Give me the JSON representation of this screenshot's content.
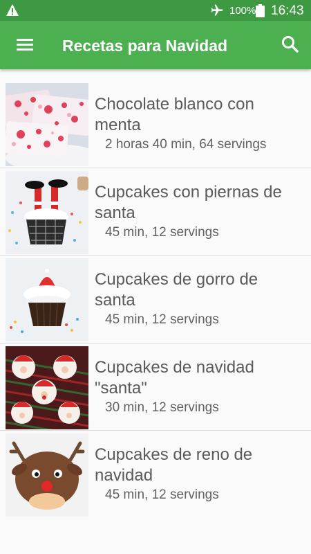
{
  "status_bar": {
    "battery_percent": "100%",
    "time": "16:43",
    "icons": [
      "warning-icon",
      "airplane-mode-icon",
      "battery-icon"
    ]
  },
  "app_bar": {
    "title": "Recetas para Navidad",
    "icons": [
      "menu-icon",
      "search-icon"
    ]
  },
  "colors": {
    "status_bar": "#3e9a42",
    "app_bar": "#4caf50",
    "background": "#fafafa"
  },
  "recipes": [
    {
      "title": "Chocolate blanco con menta",
      "meta": "2 horas 40 min, 64 servings"
    },
    {
      "title": "Cupcakes con piernas de santa",
      "meta": "45 min, 12 servings"
    },
    {
      "title": "Cupcakes de gorro de santa",
      "meta": "45 min, 12 servings"
    },
    {
      "title": "Cupcakes de navidad \"santa\"",
      "meta": "30 min, 12 servings"
    },
    {
      "title": "Cupcakes de reno de navidad",
      "meta": "45 min, 12 servings"
    }
  ]
}
